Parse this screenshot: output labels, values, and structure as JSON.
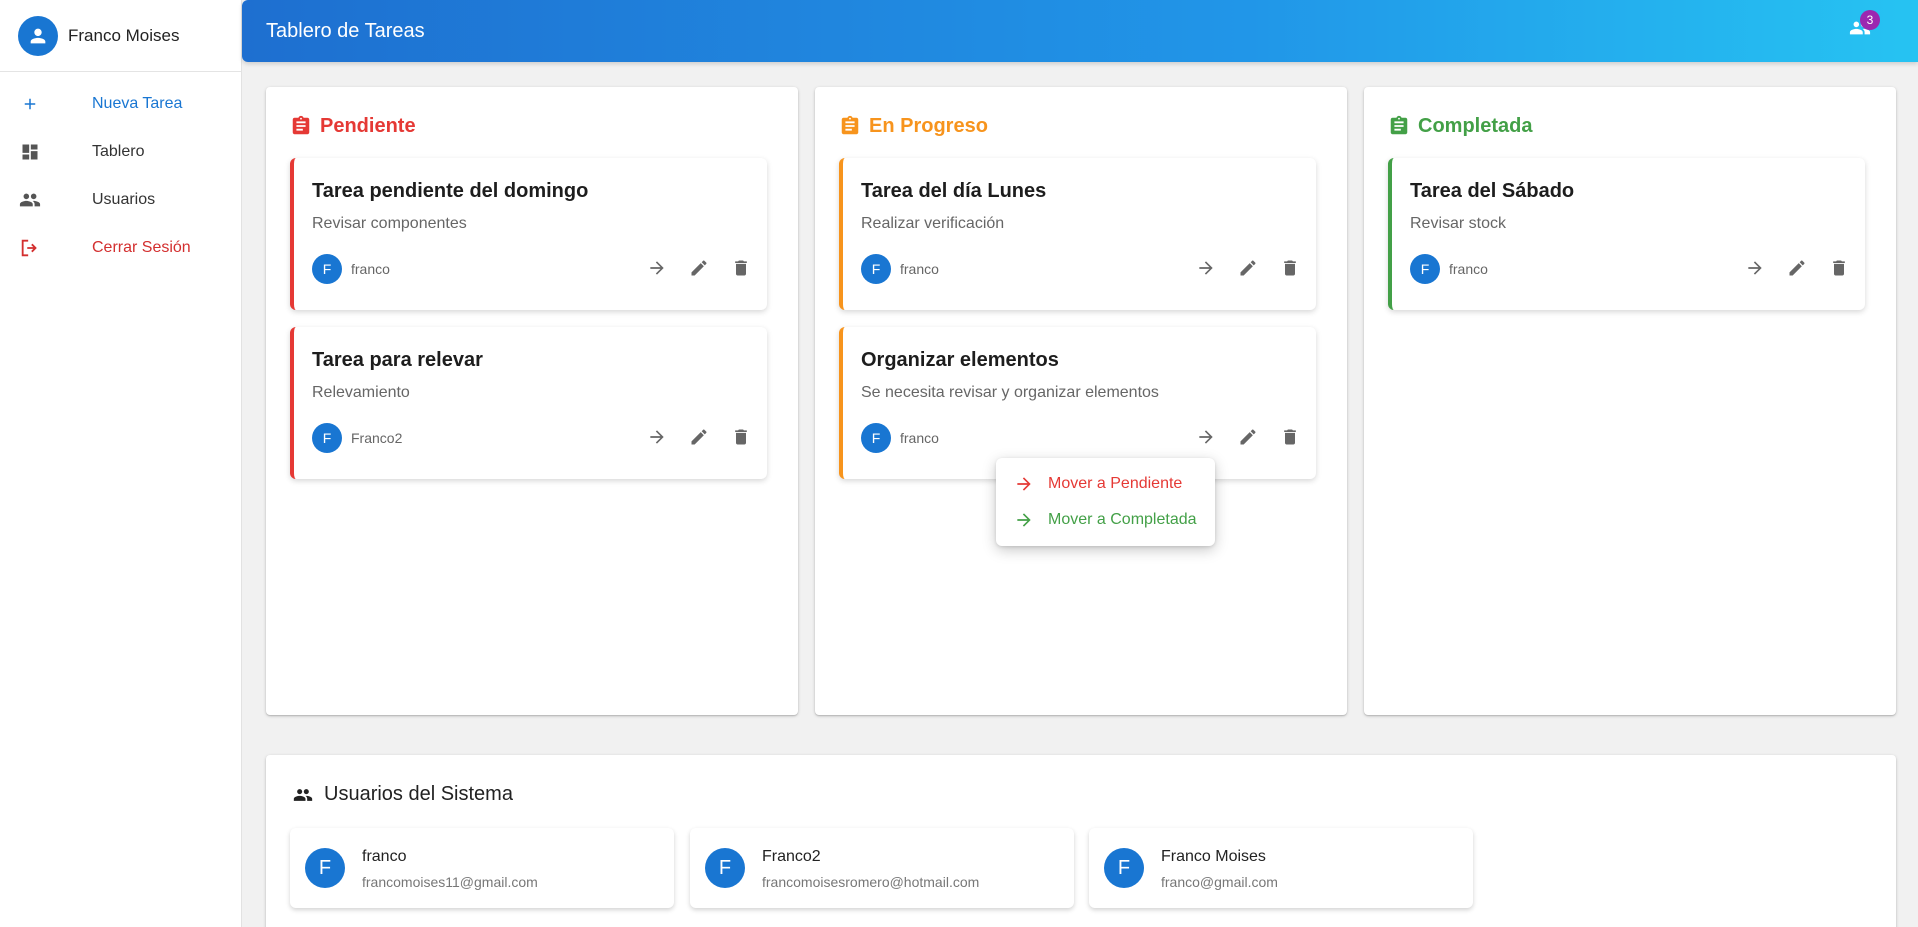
{
  "sidebar": {
    "profile_name": "Franco Moises",
    "items": [
      {
        "label": "Nueva Tarea",
        "icon": "plus-icon"
      },
      {
        "label": "Tablero",
        "icon": "dashboard-icon"
      },
      {
        "label": "Usuarios",
        "icon": "people-icon"
      },
      {
        "label": "Cerrar Sesión",
        "icon": "logout-icon"
      }
    ]
  },
  "header": {
    "title": "Tablero de Tareas",
    "notification_count": "3"
  },
  "colors": {
    "primary": "#1976d2",
    "pending": "#e53935",
    "progress": "#f7941d",
    "completed": "#43a047",
    "badge": "#9c27b0"
  },
  "columns": [
    {
      "title": "Pendiente",
      "tasks": [
        {
          "title": "Tarea pendiente del domingo",
          "description": "Revisar componentes",
          "user_initial": "F",
          "user": "franco"
        },
        {
          "title": "Tarea para relevar",
          "description": "Relevamiento",
          "user_initial": "F",
          "user": "Franco2"
        }
      ]
    },
    {
      "title": "En Progreso",
      "tasks": [
        {
          "title": "Tarea del día Lunes",
          "description": "Realizar verificación",
          "user_initial": "F",
          "user": "franco"
        },
        {
          "title": "Organizar elementos",
          "description": "Se necesita revisar y organizar elementos",
          "user_initial": "F",
          "user": "franco"
        }
      ]
    },
    {
      "title": "Completada",
      "tasks": [
        {
          "title": "Tarea del Sábado",
          "description": "Revisar stock",
          "user_initial": "F",
          "user": "franco"
        }
      ]
    }
  ],
  "move_menu": {
    "items": [
      {
        "label": "Mover a Pendiente"
      },
      {
        "label": "Mover a Completada"
      }
    ]
  },
  "users_panel": {
    "title": "Usuarios del Sistema",
    "users": [
      {
        "initial": "F",
        "name": "franco",
        "email": "francomoises11@gmail.com"
      },
      {
        "initial": "F",
        "name": "Franco2",
        "email": "francomoisesromero@hotmail.com"
      },
      {
        "initial": "F",
        "name": "Franco Moises",
        "email": "franco@gmail.com"
      }
    ]
  }
}
